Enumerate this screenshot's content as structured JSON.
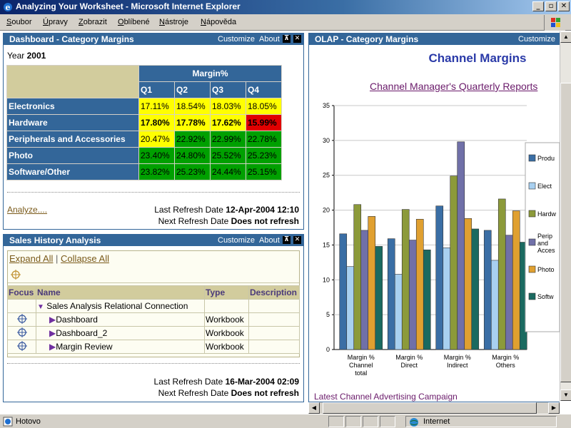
{
  "window": {
    "title": "Analyzing Your Worksheet - Microsoft Internet Explorer"
  },
  "menu": [
    "Soubor",
    "Úpravy",
    "Zobrazit",
    "Oblíbené",
    "Nástroje",
    "Nápověda"
  ],
  "dashboard": {
    "title": "Dashboard - Category Margins",
    "customize": "Customize",
    "about": "About",
    "year_label": "Year",
    "year": "2001",
    "margin_header": "Margin%",
    "quarters": [
      "Q1",
      "Q2",
      "Q3",
      "Q4"
    ],
    "rows": [
      {
        "name": "Electronics",
        "values": [
          "17.11%",
          "18.54%",
          "18.03%",
          "18.05%"
        ],
        "colors": [
          "#ffff00",
          "#ffff00",
          "#ffff00",
          "#ffff00"
        ],
        "bold": false
      },
      {
        "name": "Hardware",
        "values": [
          "17.80%",
          "17.78%",
          "17.62%",
          "15.99%"
        ],
        "colors": [
          "#ffff00",
          "#ffff00",
          "#ffff00",
          "#e00000"
        ],
        "bold": true
      },
      {
        "name": "Peripherals and Accessories",
        "values": [
          "20.47%",
          "22.92%",
          "22.99%",
          "22.78%"
        ],
        "colors": [
          "#ffff00",
          "#00a000",
          "#00a000",
          "#00a000"
        ],
        "bold": false
      },
      {
        "name": "Photo",
        "values": [
          "23.40%",
          "24.80%",
          "25.52%",
          "25.23%"
        ],
        "colors": [
          "#00a000",
          "#00a000",
          "#00a000",
          "#00a000"
        ],
        "bold": false
      },
      {
        "name": "Software/Other",
        "values": [
          "23.82%",
          "25.23%",
          "24.44%",
          "25.15%"
        ],
        "colors": [
          "#00a000",
          "#00a000",
          "#00a000",
          "#00a000"
        ],
        "bold": false
      }
    ],
    "analyze_link": "Analyze....",
    "last_refresh_label": "Last Refresh Date",
    "last_refresh": "12-Apr-2004 12:10",
    "next_refresh_label": "Next Refresh Date",
    "next_refresh": "Does not refresh"
  },
  "sales": {
    "title": "Sales History Analysis",
    "customize": "Customize",
    "about": "About",
    "expand_all": "Expand All",
    "collapse_all": "Collapse All",
    "headers": [
      "Focus",
      "Name",
      "Type",
      "Description"
    ],
    "root_name": "Sales Analysis Relational Connection",
    "items": [
      {
        "name": "Dashboard",
        "type": "Workbook",
        "desc": ""
      },
      {
        "name": "Dashboard_2",
        "type": "Workbook",
        "desc": ""
      },
      {
        "name": "Margin Review",
        "type": "Workbook",
        "desc": ""
      }
    ],
    "last_refresh_label": "Last Refresh Date",
    "last_refresh": "16-Mar-2004 02:09",
    "next_refresh_label": "Next Refresh Date",
    "next_refresh": "Does not refresh"
  },
  "olap": {
    "title": "OLAP - Category Margins",
    "customize": "Customize",
    "chart_title": "Channel Margins",
    "report_link": "Channel Manager's Quarterly Reports",
    "bottom_link": "Latest Channel Advertising Campaign"
  },
  "chart_data": {
    "type": "bar",
    "title": "Channel Margins",
    "categories": [
      [
        "Margin %",
        "Channel",
        "total"
      ],
      [
        "Margin %",
        "Direct"
      ],
      [
        "Margin %",
        "Indirect"
      ],
      [
        "Margin %",
        "Others"
      ]
    ],
    "ylim": [
      0,
      35
    ],
    "yticks": [
      0,
      5,
      10,
      15,
      20,
      25,
      30,
      35
    ],
    "series": [
      {
        "name": "Produ",
        "color": "#3a6ea5",
        "values": [
          16.6,
          15.9,
          20.6,
          17.1
        ]
      },
      {
        "name": "Elect",
        "color": "#a8d0f0",
        "values": [
          11.9,
          10.8,
          14.6,
          12.8
        ]
      },
      {
        "name": "Hardw",
        "color": "#8c9a3a",
        "values": [
          20.8,
          20.1,
          24.9,
          21.6
        ]
      },
      {
        "name": "Perip and Acces",
        "color": "#7070a8",
        "values": [
          17.1,
          15.7,
          29.8,
          16.4
        ]
      },
      {
        "name": "Photo",
        "color": "#e0a030",
        "values": [
          19.1,
          18.7,
          18.8,
          19.9
        ]
      },
      {
        "name": "Softw",
        "color": "#1a6a60",
        "values": [
          14.8,
          14.3,
          17.3,
          15.4
        ]
      }
    ],
    "grid": true,
    "legend": "right"
  },
  "status": {
    "text": "Hotovo",
    "zone": "Internet"
  }
}
